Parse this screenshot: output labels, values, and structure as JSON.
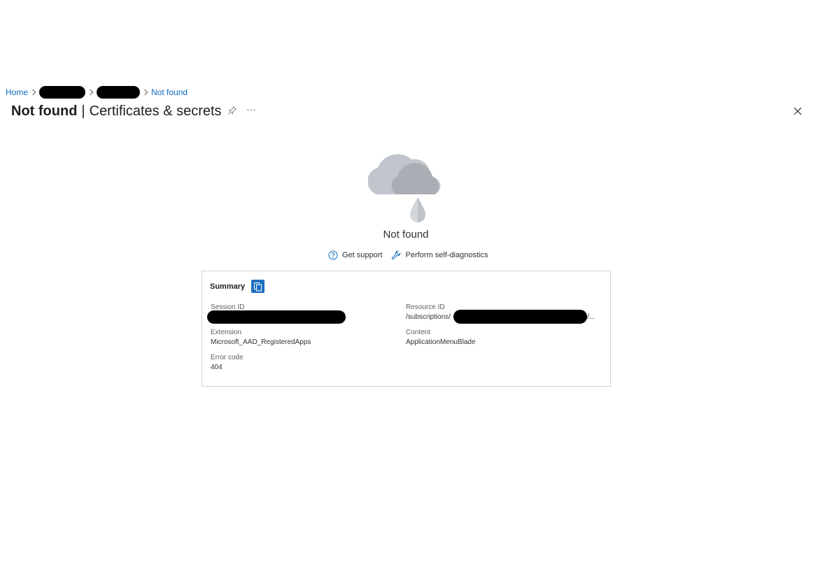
{
  "breadcrumb": {
    "home": "Home",
    "current": "Not found"
  },
  "header": {
    "title_strong": "Not found",
    "title_separator": "|",
    "title_rest": "Certificates & secrets",
    "more": "···"
  },
  "error": {
    "message": "Not found",
    "links": {
      "support": "Get support",
      "diagnostics": "Perform self-diagnostics"
    }
  },
  "summary": {
    "title": "Summary",
    "session_id_label": "Session ID",
    "resource_id_label": "Resource ID",
    "resource_id_prefix": "/subscriptions/",
    "resource_id_suffix": "/...",
    "extension_label": "Extension",
    "extension_value": "Microsoft_AAD_RegisteredApps",
    "content_label": "Content",
    "content_value": "ApplicationMenuBlade",
    "error_code_label": "Error code",
    "error_code_value": "404"
  },
  "colors": {
    "link": "#0f6cbd",
    "copy_button": "#1f6fbf",
    "cloud_back": "#c1c6cc",
    "cloud_front": "#a9aeb5"
  }
}
